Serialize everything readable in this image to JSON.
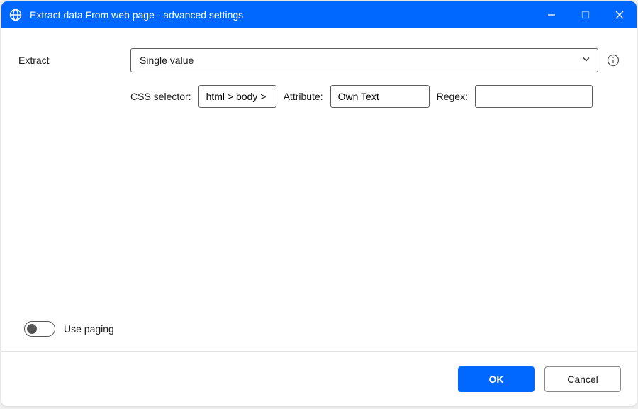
{
  "titlebar": {
    "title": "Extract data From web page - advanced settings"
  },
  "form": {
    "extract_label": "Extract",
    "extract_value": "Single value",
    "css_selector_label": "CSS selector:",
    "css_selector_value": "html > body >",
    "attribute_label": "Attribute:",
    "attribute_value": "Own Text",
    "regex_label": "Regex:",
    "regex_value": ""
  },
  "paging": {
    "label": "Use paging",
    "enabled": false
  },
  "footer": {
    "ok_label": "OK",
    "cancel_label": "Cancel"
  }
}
